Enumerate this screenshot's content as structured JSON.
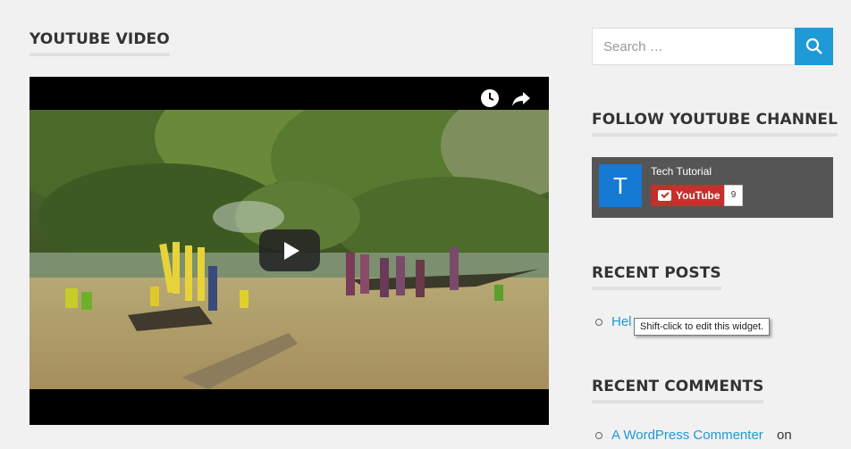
{
  "main": {
    "video_title": "YOUTUBE VIDEO"
  },
  "video": {
    "watch_later_icon": "clock-icon",
    "share_icon": "share-arrow-icon",
    "play_icon": "play-icon"
  },
  "search": {
    "placeholder": "Search …",
    "icon": "search-icon"
  },
  "follow": {
    "title": "FOLLOW YOUTUBE CHANNEL",
    "avatar_letter": "T",
    "channel_name": "Tech Tutorial",
    "button_label": "YouTube",
    "subscriber_count": "9"
  },
  "recent_posts": {
    "title": "RECENT POSTS",
    "items": [
      {
        "label": "Hel"
      }
    ]
  },
  "tooltip": {
    "text": "Shift-click to edit this widget."
  },
  "recent_comments": {
    "title": "RECENT COMMENTS",
    "items": [
      {
        "author": "A WordPress Commenter",
        "suffix": "on"
      }
    ]
  },
  "colors": {
    "background": "#f1f1f1",
    "accent": "#1e9ad6",
    "youtube_red": "#c4302b",
    "widget_bg": "#555555"
  }
}
